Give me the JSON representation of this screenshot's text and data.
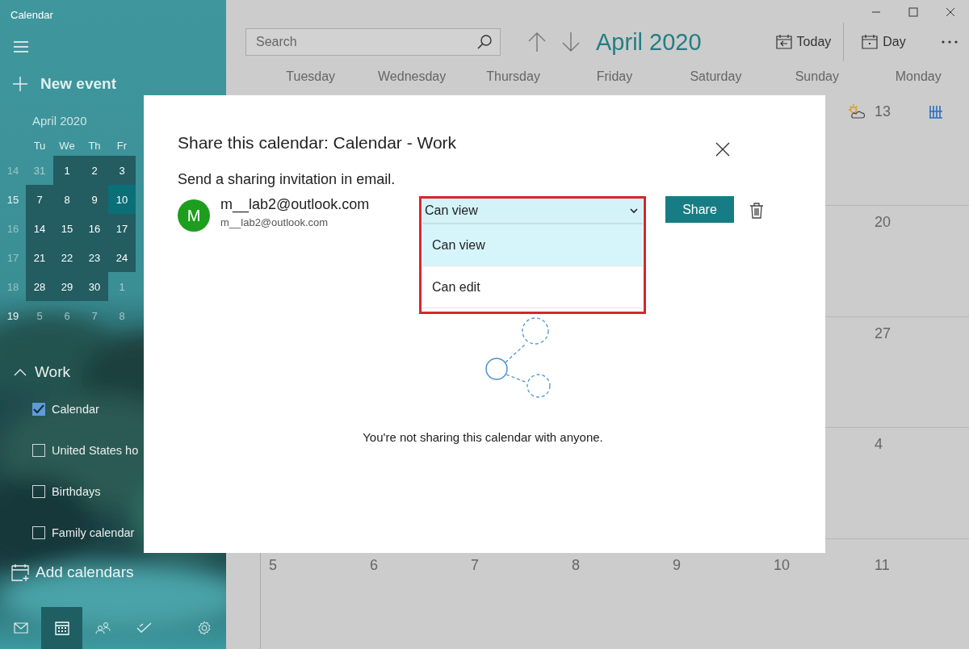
{
  "window": {
    "title": "Calendar"
  },
  "sidebar": {
    "new_event": "New event",
    "mini_calendar": {
      "title": "April 2020",
      "weekdays": [
        "Tu",
        "We",
        "Th",
        "Fr"
      ],
      "weeks": [
        {
          "number": "14",
          "bright": false,
          "days": [
            {
              "d": "31",
              "in_month": false,
              "selected": false
            },
            {
              "d": "1",
              "in_month": true,
              "selected": false
            },
            {
              "d": "2",
              "in_month": true,
              "selected": false
            },
            {
              "d": "3",
              "in_month": true,
              "selected": false
            }
          ]
        },
        {
          "number": "15",
          "bright": true,
          "days": [
            {
              "d": "7",
              "in_month": true,
              "selected": false
            },
            {
              "d": "8",
              "in_month": true,
              "selected": false
            },
            {
              "d": "9",
              "in_month": true,
              "selected": false
            },
            {
              "d": "10",
              "in_month": true,
              "selected": true
            }
          ]
        },
        {
          "number": "16",
          "bright": false,
          "days": [
            {
              "d": "14",
              "in_month": true,
              "selected": false
            },
            {
              "d": "15",
              "in_month": true,
              "selected": false
            },
            {
              "d": "16",
              "in_month": true,
              "selected": false
            },
            {
              "d": "17",
              "in_month": true,
              "selected": false
            }
          ]
        },
        {
          "number": "17",
          "bright": false,
          "days": [
            {
              "d": "21",
              "in_month": true,
              "selected": false
            },
            {
              "d": "22",
              "in_month": true,
              "selected": false
            },
            {
              "d": "23",
              "in_month": true,
              "selected": false
            },
            {
              "d": "24",
              "in_month": true,
              "selected": false
            }
          ]
        },
        {
          "number": "18",
          "bright": false,
          "days": [
            {
              "d": "28",
              "in_month": true,
              "selected": false
            },
            {
              "d": "29",
              "in_month": true,
              "selected": false
            },
            {
              "d": "30",
              "in_month": true,
              "selected": false
            },
            {
              "d": "1",
              "in_month": false,
              "selected": false
            }
          ]
        },
        {
          "number": "19",
          "bright": true,
          "days": [
            {
              "d": "5",
              "in_month": false,
              "selected": false
            },
            {
              "d": "6",
              "in_month": false,
              "selected": false
            },
            {
              "d": "7",
              "in_month": false,
              "selected": false
            },
            {
              "d": "8",
              "in_month": false,
              "selected": false
            }
          ]
        }
      ]
    },
    "group": {
      "name": "Work",
      "expanded": true,
      "calendars": [
        {
          "label": "Calendar",
          "checked": true
        },
        {
          "label": "United States ho",
          "checked": false
        },
        {
          "label": "Birthdays",
          "checked": false
        },
        {
          "label": "Family calendar",
          "checked": false
        }
      ]
    },
    "add_calendars": "Add calendars",
    "nav": [
      {
        "kind": "mail",
        "selected": false
      },
      {
        "kind": "calendar",
        "selected": true
      },
      {
        "kind": "people",
        "selected": false
      },
      {
        "kind": "tasks",
        "selected": false
      },
      {
        "kind": "settings",
        "selected": false
      }
    ]
  },
  "toolbar": {
    "search": {
      "placeholder": "Search"
    },
    "month": "April 2020",
    "today": "Today",
    "view": "Day"
  },
  "weekdays": [
    "Tuesday",
    "Wednesday",
    "Thursday",
    "Friday",
    "Saturday",
    "Sunday",
    "Monday"
  ],
  "weeks": [
    {
      "days": [
        "13"
      ]
    },
    {
      "days": [
        "20"
      ]
    },
    {
      "days": [
        "27"
      ]
    },
    {
      "days": [
        "4"
      ]
    },
    {
      "days": [
        "5",
        "6",
        "7",
        "8",
        "9",
        "10",
        "11"
      ]
    }
  ],
  "dialog": {
    "title": "Share this calendar: Calendar - Work",
    "prompt": "Send a sharing invitation in email.",
    "contact": {
      "initial": "M",
      "name": "m__lab2@outlook.com",
      "email": "m__lab2@outlook.com"
    },
    "permission": {
      "value": "Can view",
      "options": [
        {
          "label": "Can view",
          "selected": true
        },
        {
          "label": "Can edit",
          "selected": false
        }
      ]
    },
    "share": "Share",
    "empty_message": "You're not sharing this calendar with anyone."
  }
}
